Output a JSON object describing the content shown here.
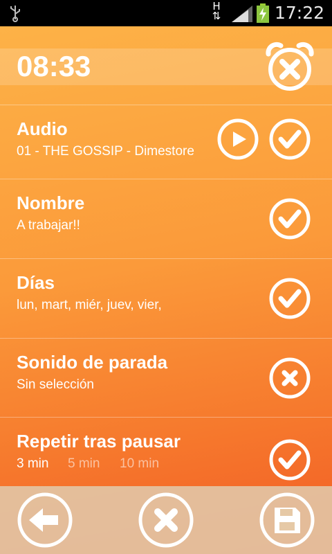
{
  "status_bar": {
    "network": "H",
    "time": "17:22",
    "icons": [
      "usb-icon",
      "network-h-icon",
      "signal-icon",
      "battery-charging-icon"
    ]
  },
  "header": {
    "time": "08:33",
    "alarm_icon": "alarm-clock-cancel-icon"
  },
  "settings": [
    {
      "title": "Audio",
      "value": "01 - THE  GOSSIP - Dimestore",
      "play_icon": "play-icon",
      "state_icon": "check-icon"
    },
    {
      "title": "Nombre",
      "value": "A trabajar!!",
      "state_icon": "check-icon"
    },
    {
      "title": "Días",
      "value": "lun, mart, miér, juev, vier,",
      "state_icon": "check-icon"
    },
    {
      "title": "Sonido de parada",
      "value": "Sin selección",
      "state_icon": "x-icon"
    },
    {
      "title": "Repetir tras pausar",
      "options": [
        "3 min",
        "5 min",
        "10 min"
      ],
      "selected": "3 min",
      "state_icon": "check-icon"
    }
  ],
  "bottom_bar": {
    "buttons": [
      "back-arrow-icon",
      "cancel-x-icon",
      "save-floppy-icon"
    ]
  },
  "colors": {
    "gradient_top": "#fdb247",
    "gradient_bottom": "#f25b24",
    "bottom_bar": "#e1c8aa",
    "icon": "#ffffff"
  }
}
